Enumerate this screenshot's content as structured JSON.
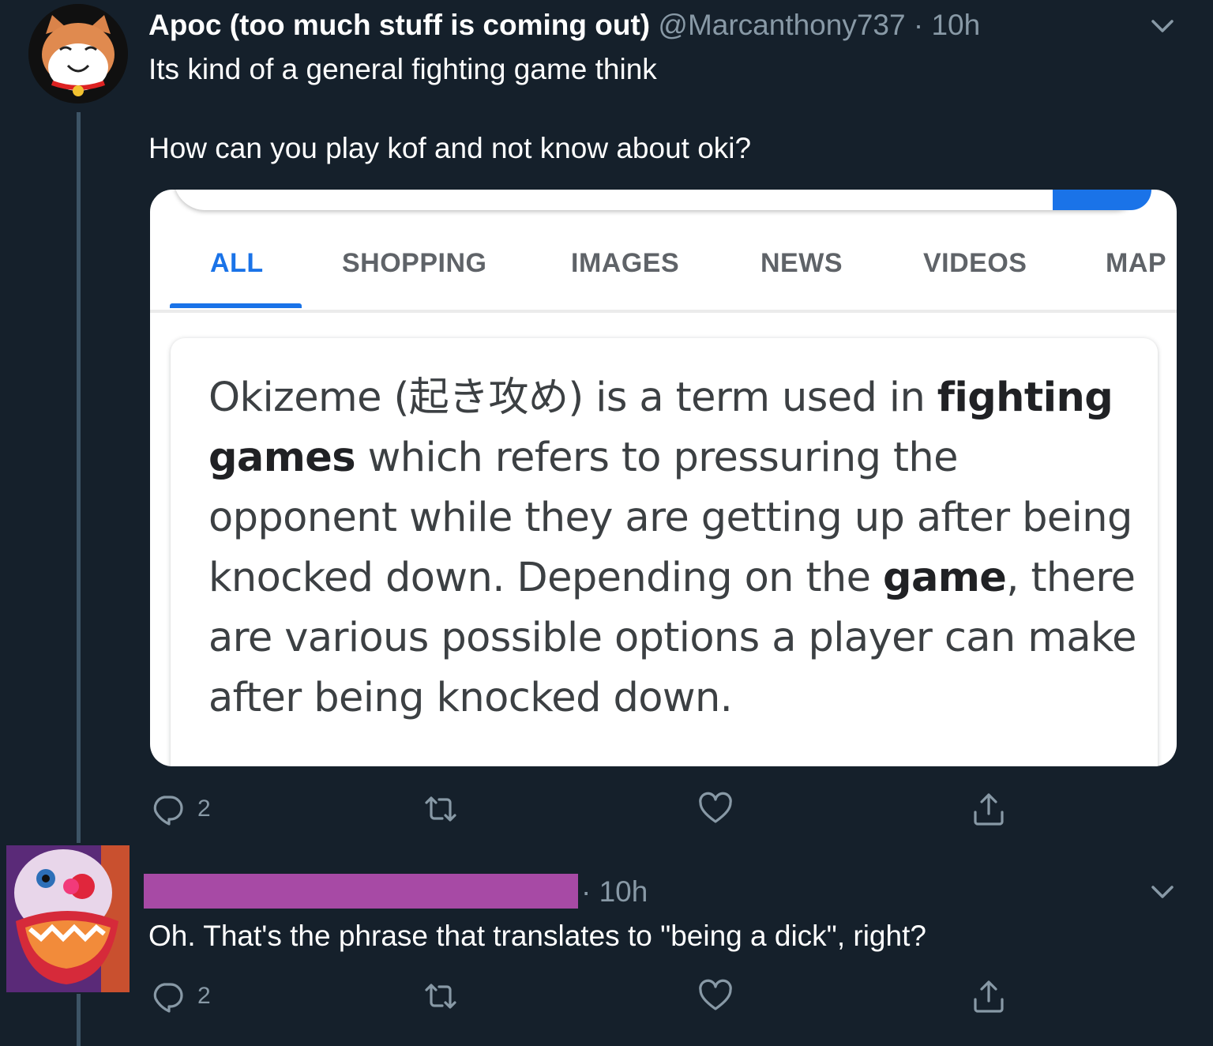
{
  "tweet1": {
    "display_name": "Apoc (too much stuff is coming out)",
    "handle": "@Marcanthony737",
    "separator": "·",
    "time": "10h",
    "text_line1": "Its kind of a general fighting game think",
    "text_line2": "How can you play kof and not know about oki?",
    "media": {
      "tabs": [
        "ALL",
        "SHOPPING",
        "IMAGES",
        "NEWS",
        "VIDEOS",
        "MAP"
      ],
      "active_tab": "ALL",
      "snippet": {
        "part1": "Okizeme (起き攻め) is a term used in ",
        "bold1": "fighting games",
        "part2": " which refers to pressuring the opponent while they are getting up after being knocked down. Depending on the ",
        "bold2": "game",
        "part3": ", there are various possible options a player can make after being knocked down."
      }
    },
    "actions": {
      "reply_count": "2",
      "retweet_count": "",
      "like_count": ""
    }
  },
  "tweet2": {
    "separator": "·",
    "time": "10h",
    "text": "Oh. That's the phrase that translates to \"being a dick\", right?",
    "actions": {
      "reply_count": "2",
      "retweet_count": "",
      "like_count": ""
    }
  },
  "colors": {
    "background": "#15202b",
    "secondary_text": "#8899a6",
    "google_blue": "#1a73e8",
    "redaction": "#a74aa5"
  },
  "icons": [
    "reply-icon",
    "retweet-icon",
    "like-icon",
    "share-icon",
    "chevron-down-icon"
  ]
}
